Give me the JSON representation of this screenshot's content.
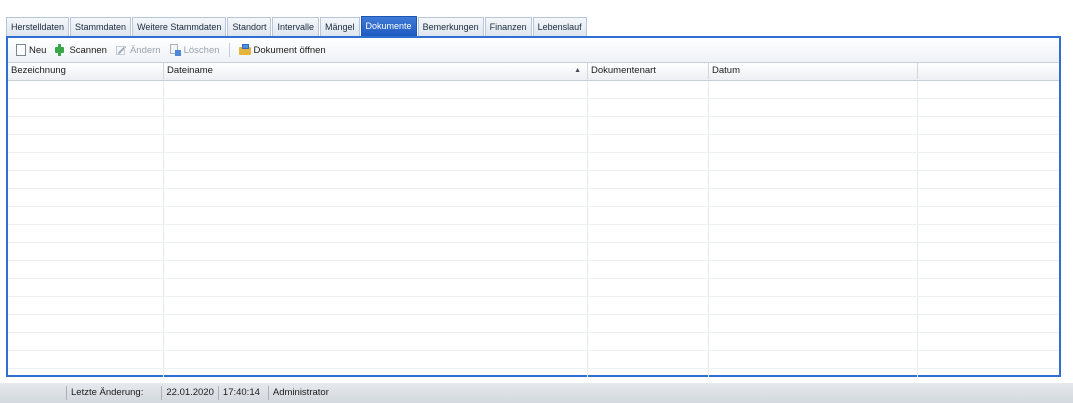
{
  "tabs": [
    {
      "label": "Herstelldaten",
      "active": false
    },
    {
      "label": "Stammdaten",
      "active": false
    },
    {
      "label": "Weitere Stammdaten",
      "active": false
    },
    {
      "label": "Standort",
      "active": false
    },
    {
      "label": "Intervalle",
      "active": false
    },
    {
      "label": "Mängel",
      "active": false
    },
    {
      "label": "Dokumente",
      "active": true
    },
    {
      "label": "Bemerkungen",
      "active": false
    },
    {
      "label": "Finanzen",
      "active": false
    },
    {
      "label": "Lebenslauf",
      "active": false
    }
  ],
  "toolbar": {
    "new_label": "Neu",
    "scan_label": "Scannen",
    "edit_label": "Ändern",
    "delete_label": "Löschen",
    "open_label": "Dokument öffnen"
  },
  "grid": {
    "columns": [
      "Bezeichnung",
      "Dateiname",
      "Dokumentenart",
      "Datum",
      ""
    ],
    "sort_indicator": "▲",
    "rows": []
  },
  "status": {
    "last_change_label": "Letzte Änderung:",
    "date": "22.01.2020",
    "time": "17:40:14",
    "user": "Administrator"
  },
  "colors": {
    "accent": "#2f6fd3",
    "active_tab": "#1e5bc0"
  }
}
